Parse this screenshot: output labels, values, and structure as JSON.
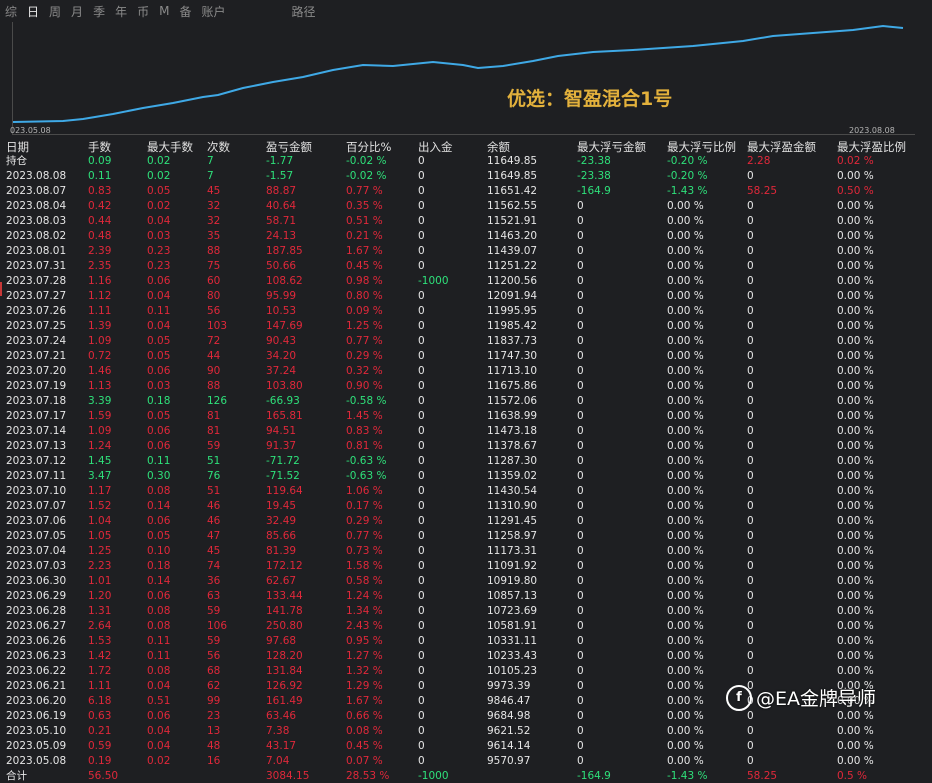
{
  "tabs": [
    "综",
    "日",
    "周",
    "月",
    "季",
    "年",
    "币",
    "M",
    "备",
    "账户",
    "路径"
  ],
  "chart": {
    "label": "优选：智盈混合1号",
    "start_date": "023.05.08",
    "end_date": "2023.08.08",
    "line_color": "#3fa9e6"
  },
  "columns": [
    "日期",
    "手数",
    "最大手数",
    "次数",
    "盈亏金额",
    "百分比%",
    "出入金",
    "余额",
    "最大浮亏金额",
    "最大浮亏比例",
    "最大浮盈金额",
    "最大浮盈比例"
  ],
  "rows": [
    {
      "d": "持仓",
      "lots": "0.09",
      "max": "0.02",
      "n": "7",
      "pl": "-1.77",
      "pct": "-0.02 %",
      "io": "0",
      "bal": "11649.85",
      "fl": "-23.38",
      "flp": "-0.20 %",
      "fp": "2.28",
      "fpp": "0.02 %",
      "c": "g",
      "fpc": "r"
    },
    {
      "d": "2023.08.08",
      "lots": "0.11",
      "max": "0.02",
      "n": "7",
      "pl": "-1.57",
      "pct": "-0.02 %",
      "io": "0",
      "bal": "11649.85",
      "fl": "-23.38",
      "flp": "-0.20 %",
      "fp": "0",
      "fpp": "0.00 %",
      "c": "g",
      "fpc": "w"
    },
    {
      "d": "2023.08.07",
      "lots": "0.83",
      "max": "0.05",
      "n": "45",
      "pl": "88.87",
      "pct": "0.77 %",
      "io": "0",
      "bal": "11651.42",
      "fl": "-164.9",
      "flp": "-1.43 %",
      "fp": "58.25",
      "fpp": "0.50 %",
      "c": "r",
      "fpc": "r"
    },
    {
      "d": "2023.08.04",
      "lots": "0.42",
      "max": "0.02",
      "n": "32",
      "pl": "40.64",
      "pct": "0.35 %",
      "io": "0",
      "bal": "11562.55",
      "fl": "0",
      "flp": "0.00 %",
      "fp": "0",
      "fpp": "0.00 %",
      "c": "r",
      "fpc": "w"
    },
    {
      "d": "2023.08.03",
      "lots": "0.44",
      "max": "0.04",
      "n": "32",
      "pl": "58.71",
      "pct": "0.51 %",
      "io": "0",
      "bal": "11521.91",
      "fl": "0",
      "flp": "0.00 %",
      "fp": "0",
      "fpp": "0.00 %",
      "c": "r",
      "fpc": "w"
    },
    {
      "d": "2023.08.02",
      "lots": "0.48",
      "max": "0.03",
      "n": "35",
      "pl": "24.13",
      "pct": "0.21 %",
      "io": "0",
      "bal": "11463.20",
      "fl": "0",
      "flp": "0.00 %",
      "fp": "0",
      "fpp": "0.00 %",
      "c": "r",
      "fpc": "w"
    },
    {
      "d": "2023.08.01",
      "lots": "2.39",
      "max": "0.23",
      "n": "88",
      "pl": "187.85",
      "pct": "1.67 %",
      "io": "0",
      "bal": "11439.07",
      "fl": "0",
      "flp": "0.00 %",
      "fp": "0",
      "fpp": "0.00 %",
      "c": "r",
      "fpc": "w"
    },
    {
      "d": "2023.07.31",
      "lots": "2.35",
      "max": "0.23",
      "n": "75",
      "pl": "50.66",
      "pct": "0.45 %",
      "io": "0",
      "bal": "11251.22",
      "fl": "0",
      "flp": "0.00 %",
      "fp": "0",
      "fpp": "0.00 %",
      "c": "r",
      "fpc": "w"
    },
    {
      "d": "2023.07.28",
      "lots": "1.16",
      "max": "0.06",
      "n": "60",
      "pl": "108.62",
      "pct": "0.98 %",
      "io": "-1000",
      "bal": "11200.56",
      "fl": "0",
      "flp": "0.00 %",
      "fp": "0",
      "fpp": "0.00 %",
      "c": "r",
      "fpc": "w",
      "ioc": "g"
    },
    {
      "d": "2023.07.27",
      "lots": "1.12",
      "max": "0.04",
      "n": "80",
      "pl": "95.99",
      "pct": "0.80 %",
      "io": "0",
      "bal": "12091.94",
      "fl": "0",
      "flp": "0.00 %",
      "fp": "0",
      "fpp": "0.00 %",
      "c": "r",
      "fpc": "w"
    },
    {
      "d": "2023.07.26",
      "lots": "1.11",
      "max": "0.11",
      "n": "56",
      "pl": "10.53",
      "pct": "0.09 %",
      "io": "0",
      "bal": "11995.95",
      "fl": "0",
      "flp": "0.00 %",
      "fp": "0",
      "fpp": "0.00 %",
      "c": "r",
      "fpc": "w"
    },
    {
      "d": "2023.07.25",
      "lots": "1.39",
      "max": "0.04",
      "n": "103",
      "pl": "147.69",
      "pct": "1.25 %",
      "io": "0",
      "bal": "11985.42",
      "fl": "0",
      "flp": "0.00 %",
      "fp": "0",
      "fpp": "0.00 %",
      "c": "r",
      "fpc": "w"
    },
    {
      "d": "2023.07.24",
      "lots": "1.09",
      "max": "0.05",
      "n": "72",
      "pl": "90.43",
      "pct": "0.77 %",
      "io": "0",
      "bal": "11837.73",
      "fl": "0",
      "flp": "0.00 %",
      "fp": "0",
      "fpp": "0.00 %",
      "c": "r",
      "fpc": "w"
    },
    {
      "d": "2023.07.21",
      "lots": "0.72",
      "max": "0.05",
      "n": "44",
      "pl": "34.20",
      "pct": "0.29 %",
      "io": "0",
      "bal": "11747.30",
      "fl": "0",
      "flp": "0.00 %",
      "fp": "0",
      "fpp": "0.00 %",
      "c": "r",
      "fpc": "w"
    },
    {
      "d": "2023.07.20",
      "lots": "1.46",
      "max": "0.06",
      "n": "90",
      "pl": "37.24",
      "pct": "0.32 %",
      "io": "0",
      "bal": "11713.10",
      "fl": "0",
      "flp": "0.00 %",
      "fp": "0",
      "fpp": "0.00 %",
      "c": "r",
      "fpc": "w"
    },
    {
      "d": "2023.07.19",
      "lots": "1.13",
      "max": "0.03",
      "n": "88",
      "pl": "103.80",
      "pct": "0.90 %",
      "io": "0",
      "bal": "11675.86",
      "fl": "0",
      "flp": "0.00 %",
      "fp": "0",
      "fpp": "0.00 %",
      "c": "r",
      "fpc": "w"
    },
    {
      "d": "2023.07.18",
      "lots": "3.39",
      "max": "0.18",
      "n": "126",
      "pl": "-66.93",
      "pct": "-0.58 %",
      "io": "0",
      "bal": "11572.06",
      "fl": "0",
      "flp": "0.00 %",
      "fp": "0",
      "fpp": "0.00 %",
      "c": "g",
      "fpc": "w"
    },
    {
      "d": "2023.07.17",
      "lots": "1.59",
      "max": "0.05",
      "n": "81",
      "pl": "165.81",
      "pct": "1.45 %",
      "io": "0",
      "bal": "11638.99",
      "fl": "0",
      "flp": "0.00 %",
      "fp": "0",
      "fpp": "0.00 %",
      "c": "r",
      "fpc": "w"
    },
    {
      "d": "2023.07.14",
      "lots": "1.09",
      "max": "0.06",
      "n": "81",
      "pl": "94.51",
      "pct": "0.83 %",
      "io": "0",
      "bal": "11473.18",
      "fl": "0",
      "flp": "0.00 %",
      "fp": "0",
      "fpp": "0.00 %",
      "c": "r",
      "fpc": "w"
    },
    {
      "d": "2023.07.13",
      "lots": "1.24",
      "max": "0.06",
      "n": "59",
      "pl": "91.37",
      "pct": "0.81 %",
      "io": "0",
      "bal": "11378.67",
      "fl": "0",
      "flp": "0.00 %",
      "fp": "0",
      "fpp": "0.00 %",
      "c": "r",
      "fpc": "w"
    },
    {
      "d": "2023.07.12",
      "lots": "1.45",
      "max": "0.11",
      "n": "51",
      "pl": "-71.72",
      "pct": "-0.63 %",
      "io": "0",
      "bal": "11287.30",
      "fl": "0",
      "flp": "0.00 %",
      "fp": "0",
      "fpp": "0.00 %",
      "c": "g",
      "fpc": "w"
    },
    {
      "d": "2023.07.11",
      "lots": "3.47",
      "max": "0.30",
      "n": "76",
      "pl": "-71.52",
      "pct": "-0.63 %",
      "io": "0",
      "bal": "11359.02",
      "fl": "0",
      "flp": "0.00 %",
      "fp": "0",
      "fpp": "0.00 %",
      "c": "g",
      "fpc": "w"
    },
    {
      "d": "2023.07.10",
      "lots": "1.17",
      "max": "0.08",
      "n": "51",
      "pl": "119.64",
      "pct": "1.06 %",
      "io": "0",
      "bal": "11430.54",
      "fl": "0",
      "flp": "0.00 %",
      "fp": "0",
      "fpp": "0.00 %",
      "c": "r",
      "fpc": "w"
    },
    {
      "d": "2023.07.07",
      "lots": "1.52",
      "max": "0.14",
      "n": "46",
      "pl": "19.45",
      "pct": "0.17 %",
      "io": "0",
      "bal": "11310.90",
      "fl": "0",
      "flp": "0.00 %",
      "fp": "0",
      "fpp": "0.00 %",
      "c": "r",
      "fpc": "w"
    },
    {
      "d": "2023.07.06",
      "lots": "1.04",
      "max": "0.06",
      "n": "46",
      "pl": "32.49",
      "pct": "0.29 %",
      "io": "0",
      "bal": "11291.45",
      "fl": "0",
      "flp": "0.00 %",
      "fp": "0",
      "fpp": "0.00 %",
      "c": "r",
      "fpc": "w"
    },
    {
      "d": "2023.07.05",
      "lots": "1.05",
      "max": "0.05",
      "n": "47",
      "pl": "85.66",
      "pct": "0.77 %",
      "io": "0",
      "bal": "11258.97",
      "fl": "0",
      "flp": "0.00 %",
      "fp": "0",
      "fpp": "0.00 %",
      "c": "r",
      "fpc": "w"
    },
    {
      "d": "2023.07.04",
      "lots": "1.25",
      "max": "0.10",
      "n": "45",
      "pl": "81.39",
      "pct": "0.73 %",
      "io": "0",
      "bal": "11173.31",
      "fl": "0",
      "flp": "0.00 %",
      "fp": "0",
      "fpp": "0.00 %",
      "c": "r",
      "fpc": "w"
    },
    {
      "d": "2023.07.03",
      "lots": "2.23",
      "max": "0.18",
      "n": "74",
      "pl": "172.12",
      "pct": "1.58 %",
      "io": "0",
      "bal": "11091.92",
      "fl": "0",
      "flp": "0.00 %",
      "fp": "0",
      "fpp": "0.00 %",
      "c": "r",
      "fpc": "w"
    },
    {
      "d": "2023.06.30",
      "lots": "1.01",
      "max": "0.14",
      "n": "36",
      "pl": "62.67",
      "pct": "0.58 %",
      "io": "0",
      "bal": "10919.80",
      "fl": "0",
      "flp": "0.00 %",
      "fp": "0",
      "fpp": "0.00 %",
      "c": "r",
      "fpc": "w"
    },
    {
      "d": "2023.06.29",
      "lots": "1.20",
      "max": "0.06",
      "n": "63",
      "pl": "133.44",
      "pct": "1.24 %",
      "io": "0",
      "bal": "10857.13",
      "fl": "0",
      "flp": "0.00 %",
      "fp": "0",
      "fpp": "0.00 %",
      "c": "r",
      "fpc": "w"
    },
    {
      "d": "2023.06.28",
      "lots": "1.31",
      "max": "0.08",
      "n": "59",
      "pl": "141.78",
      "pct": "1.34 %",
      "io": "0",
      "bal": "10723.69",
      "fl": "0",
      "flp": "0.00 %",
      "fp": "0",
      "fpp": "0.00 %",
      "c": "r",
      "fpc": "w"
    },
    {
      "d": "2023.06.27",
      "lots": "2.64",
      "max": "0.08",
      "n": "106",
      "pl": "250.80",
      "pct": "2.43 %",
      "io": "0",
      "bal": "10581.91",
      "fl": "0",
      "flp": "0.00 %",
      "fp": "0",
      "fpp": "0.00 %",
      "c": "r",
      "fpc": "w"
    },
    {
      "d": "2023.06.26",
      "lots": "1.53",
      "max": "0.11",
      "n": "59",
      "pl": "97.68",
      "pct": "0.95 %",
      "io": "0",
      "bal": "10331.11",
      "fl": "0",
      "flp": "0.00 %",
      "fp": "0",
      "fpp": "0.00 %",
      "c": "r",
      "fpc": "w"
    },
    {
      "d": "2023.06.23",
      "lots": "1.42",
      "max": "0.11",
      "n": "56",
      "pl": "128.20",
      "pct": "1.27 %",
      "io": "0",
      "bal": "10233.43",
      "fl": "0",
      "flp": "0.00 %",
      "fp": "0",
      "fpp": "0.00 %",
      "c": "r",
      "fpc": "w"
    },
    {
      "d": "2023.06.22",
      "lots": "1.72",
      "max": "0.08",
      "n": "68",
      "pl": "131.84",
      "pct": "1.32 %",
      "io": "0",
      "bal": "10105.23",
      "fl": "0",
      "flp": "0.00 %",
      "fp": "0",
      "fpp": "0.00 %",
      "c": "r",
      "fpc": "w"
    },
    {
      "d": "2023.06.21",
      "lots": "1.11",
      "max": "0.04",
      "n": "62",
      "pl": "126.92",
      "pct": "1.29 %",
      "io": "0",
      "bal": "9973.39",
      "fl": "0",
      "flp": "0.00 %",
      "fp": "0",
      "fpp": "0.00 %",
      "c": "r",
      "fpc": "w"
    },
    {
      "d": "2023.06.20",
      "lots": "6.18",
      "max": "0.51",
      "n": "99",
      "pl": "161.49",
      "pct": "1.67 %",
      "io": "0",
      "bal": "9846.47",
      "fl": "0",
      "flp": "0.00 %",
      "fp": "0",
      "fpp": "0.00 %",
      "c": "r",
      "fpc": "w"
    },
    {
      "d": "2023.06.19",
      "lots": "0.63",
      "max": "0.06",
      "n": "23",
      "pl": "63.46",
      "pct": "0.66 %",
      "io": "0",
      "bal": "9684.98",
      "fl": "0",
      "flp": "0.00 %",
      "fp": "0",
      "fpp": "0.00 %",
      "c": "r",
      "fpc": "w"
    },
    {
      "d": "2023.05.10",
      "lots": "0.21",
      "max": "0.04",
      "n": "13",
      "pl": "7.38",
      "pct": "0.08 %",
      "io": "0",
      "bal": "9621.52",
      "fl": "0",
      "flp": "0.00 %",
      "fp": "0",
      "fpp": "0.00 %",
      "c": "r",
      "fpc": "w"
    },
    {
      "d": "2023.05.09",
      "lots": "0.59",
      "max": "0.04",
      "n": "48",
      "pl": "43.17",
      "pct": "0.45 %",
      "io": "0",
      "bal": "9614.14",
      "fl": "0",
      "flp": "0.00 %",
      "fp": "0",
      "fpp": "0.00 %",
      "c": "r",
      "fpc": "w"
    },
    {
      "d": "2023.05.08",
      "lots": "0.19",
      "max": "0.02",
      "n": "16",
      "pl": "7.04",
      "pct": "0.07 %",
      "io": "0",
      "bal": "9570.97",
      "fl": "0",
      "flp": "0.00 %",
      "fp": "0",
      "fpp": "0.00 %",
      "c": "r",
      "fpc": "w"
    }
  ],
  "total": {
    "d": "合计",
    "lots": "56.50",
    "pl": "3084.15",
    "pct": "28.53 %",
    "io": "-1000",
    "fl": "-164.9",
    "flp": "-1.43 %",
    "fp": "58.25",
    "fpp": "0.5 %"
  },
  "watermark": "@EA金牌导师"
}
